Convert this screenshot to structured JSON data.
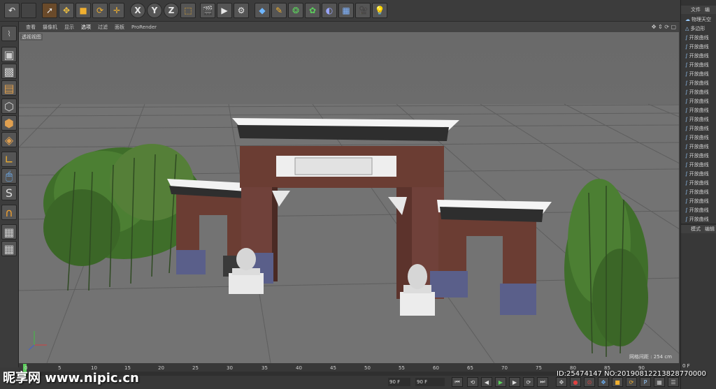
{
  "toolbar": {
    "undo_icon": "undo-icon",
    "axis_buttons": [
      "X",
      "Y",
      "Z"
    ]
  },
  "viewport_menu": {
    "items": [
      "查看",
      "摄像机",
      "显示",
      "选项",
      "过滤",
      "面板",
      "ProRender"
    ],
    "active": "选项",
    "view_label": "透视视图",
    "grid_spacing": "网格间距 : 254 cm"
  },
  "right_panel": {
    "top_menu": [
      "文件",
      "编"
    ],
    "objects": [
      "物理天空",
      "多边形",
      "开放曲线",
      "开放曲线",
      "开放曲线",
      "开放曲线",
      "开放曲线",
      "开放曲线",
      "开放曲线",
      "开放曲线",
      "开放曲线",
      "开放曲线",
      "开放曲线",
      "开放曲线",
      "开放曲线",
      "开放曲线",
      "开放曲线",
      "开放曲线",
      "开放曲线",
      "开放曲线",
      "开放曲线",
      "开放曲线",
      "开放曲线"
    ],
    "bottom_menu": [
      "模式",
      "编辑"
    ]
  },
  "timeline": {
    "ticks": [
      "0",
      "5",
      "10",
      "15",
      "20",
      "25",
      "30",
      "35",
      "40",
      "45",
      "50",
      "55",
      "60",
      "65",
      "70",
      "75",
      "80",
      "85",
      "90"
    ],
    "current_frame": "0 F",
    "start_frame": "0 F",
    "end_frame_a": "90 F",
    "end_frame_b": "90 F"
  },
  "watermark": {
    "site": "昵享网 www.nipic.cn",
    "id_text": "ID:25474147 NO:20190812213828770000"
  }
}
